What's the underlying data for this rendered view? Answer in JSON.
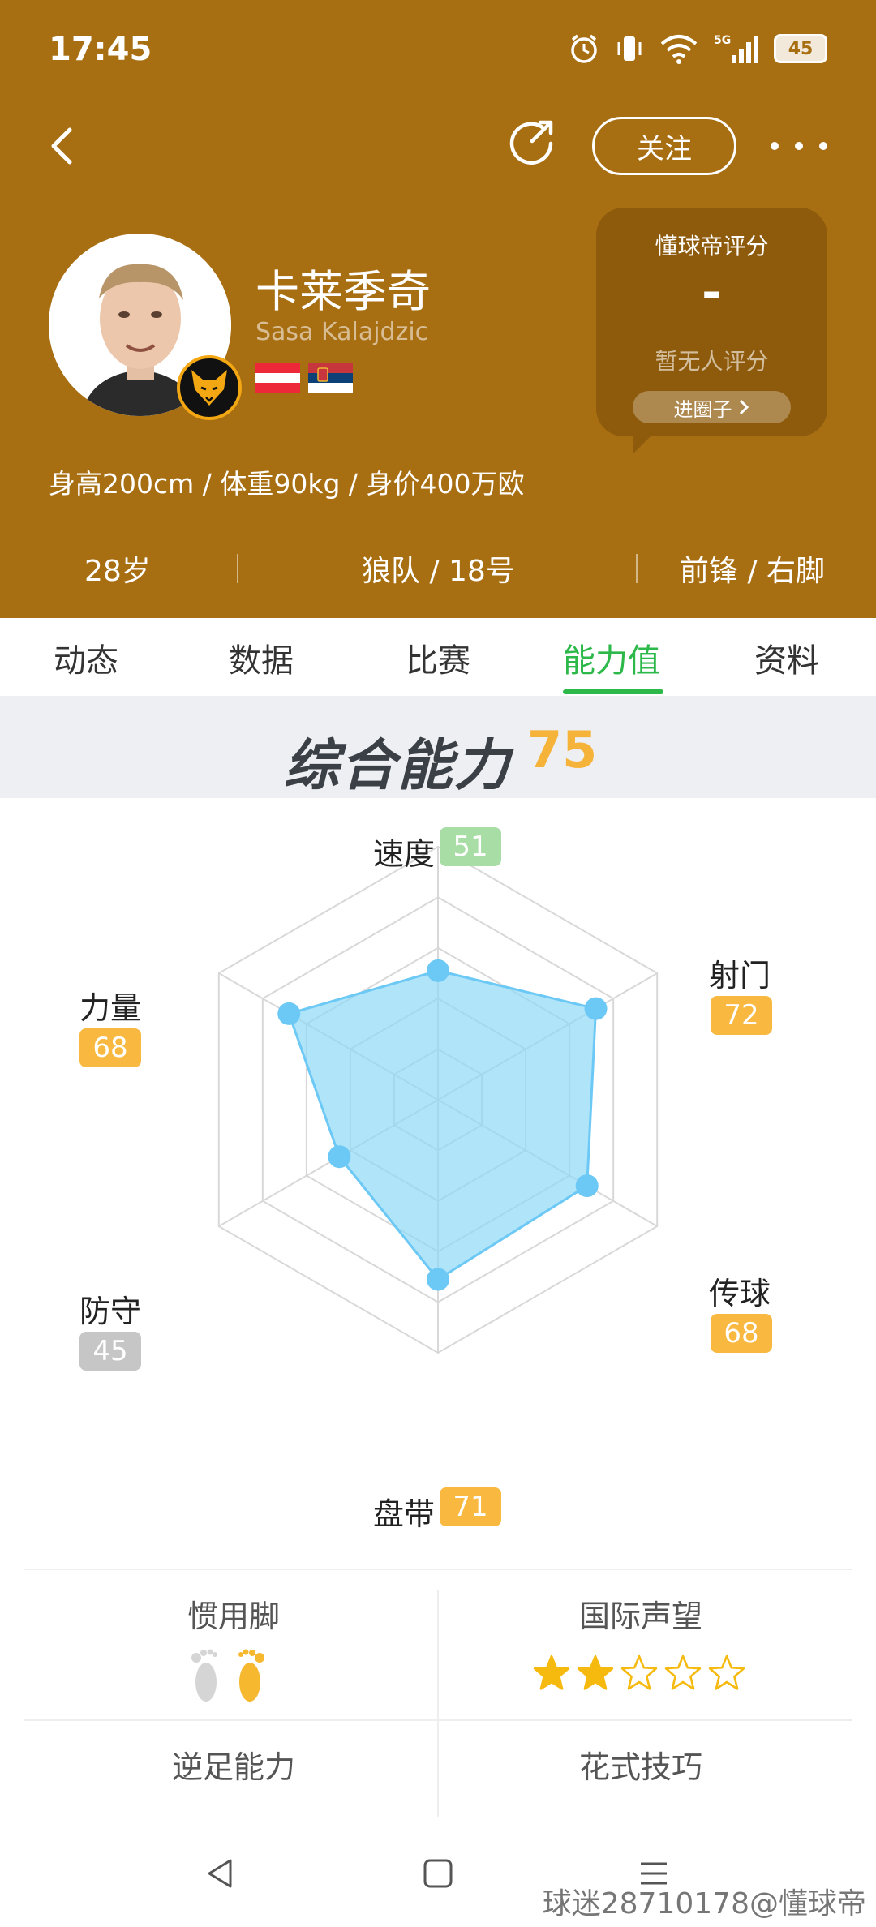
{
  "status_bar": {
    "time": "17:45",
    "battery": "45",
    "network": "5G"
  },
  "nav": {
    "follow_label": "关注"
  },
  "player": {
    "name_cn": "卡莱季奇",
    "name_en": "Sasa Kalajdzic",
    "body_info": "身高200cm / 体重90kg / 身价400万欧",
    "age": "28岁",
    "club_number": "狼队 / 18号",
    "position_foot": "前锋 / 右脚",
    "nationality_flags": [
      "austria-flag",
      "serbia-flag"
    ]
  },
  "rating_card": {
    "title": "懂球帝评分",
    "value": "-",
    "note": "暂无人评分",
    "circle_button": "进圈子"
  },
  "tabs": [
    "动态",
    "数据",
    "比赛",
    "能力值",
    "资料"
  ],
  "active_tab": 3,
  "overall": {
    "label": "综合能力",
    "score": "75"
  },
  "chart_data": {
    "type": "radar",
    "axes": [
      {
        "label": "速度",
        "value": 51,
        "badge": "51",
        "badge_color": "#A9DDA6"
      },
      {
        "label": "射门",
        "value": 72,
        "badge": "72",
        "badge_color": "#F9B941"
      },
      {
        "label": "传球",
        "value": 68,
        "badge": "68",
        "badge_color": "#F9B941"
      },
      {
        "label": "盘带",
        "value": 71,
        "badge": "71",
        "badge_color": "#F9B941"
      },
      {
        "label": "防守",
        "value": 45,
        "badge": "45",
        "badge_color": "#C6C6C6"
      },
      {
        "label": "力量",
        "value": 68,
        "badge": "68",
        "badge_color": "#F9B941"
      }
    ],
    "range": [
      0,
      100
    ],
    "fill_color": "#8FD8F7",
    "point_color": "#6CC8F5"
  },
  "attributes": {
    "preferred_foot_label": "惯用脚",
    "preferred_foot": "right",
    "reputation_label": "国际声望",
    "reputation_stars": 2,
    "reputation_max": 5,
    "weak_foot_label": "逆足能力",
    "skill_moves_label": "花式技巧"
  },
  "watermark": "球迷28710178@懂球帝",
  "colors": {
    "header_bg": "#A86E12",
    "accent_green": "#2DB84A",
    "score_orange": "#F6B33A"
  }
}
